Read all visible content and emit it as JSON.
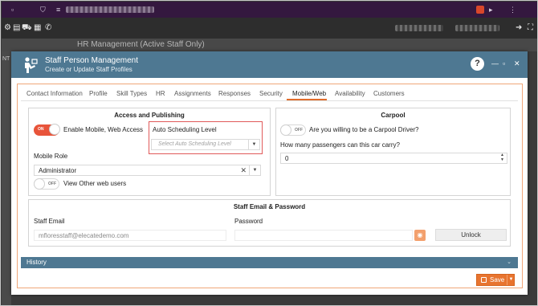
{
  "modal": {
    "title": "Staff Person Management",
    "subtitle": "Create or Update Staff Profiles",
    "help_label": "?"
  },
  "background_app": {
    "title": "HR Management (Active Staff Only)",
    "rail_text": "NT"
  },
  "tabs": [
    {
      "label": "Contact Information"
    },
    {
      "label": "Profile"
    },
    {
      "label": "Skill Types"
    },
    {
      "label": "HR"
    },
    {
      "label": "Assignments"
    },
    {
      "label": "Responses"
    },
    {
      "label": "Security"
    },
    {
      "label": "Mobile/Web",
      "active": true
    },
    {
      "label": "Availability"
    },
    {
      "label": "Customers"
    }
  ],
  "access": {
    "title": "Access and Publishing",
    "enable_toggle_state": "ON",
    "enable_label": "Enable Mobile, Web Access",
    "auto_sched_label": "Auto Scheduling Level",
    "auto_sched_placeholder": "Select Auto Scheduling Level",
    "mobile_role_label": "Mobile Role",
    "mobile_role_value": "Administrator",
    "view_toggle_state": "OFF",
    "view_label": "View Other web users"
  },
  "carpool": {
    "title": "Carpool",
    "driver_toggle_state": "OFF",
    "driver_question": "Are you willing to be a Carpool Driver?",
    "passengers_question": "How many passengers can this car carry?",
    "passengers_value": "0"
  },
  "email_password": {
    "title": "Staff Email & Password",
    "email_label": "Staff Email",
    "email_value": "mfloresstaff@elecatedemo.com",
    "password_label": "Password",
    "unlock_label": "Unlock"
  },
  "history": {
    "label": "History"
  },
  "footer": {
    "save_label": "Save"
  },
  "colors": {
    "header": "#4e7892",
    "accent": "#e16c2b",
    "toggle_on": "#e8543a",
    "highlight_border": "#e05a5a",
    "browser_bar": "#34183f"
  }
}
